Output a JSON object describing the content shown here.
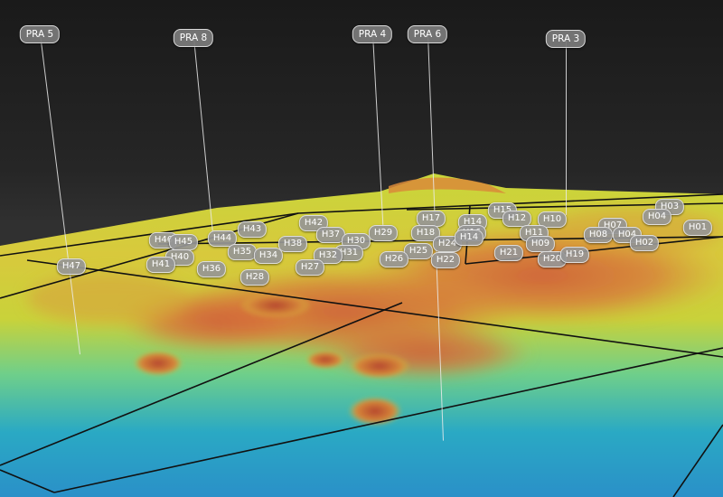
{
  "scene": {
    "colors": {
      "sky": "#1c1c1c",
      "low": "#2aa9c4",
      "mid": "#c8d63a",
      "high": "#d2683a",
      "grid_lines": "#111111",
      "label_bg": "#969696"
    },
    "pra_markers": [
      "PRA 5",
      "PRA 8",
      "PRA 4",
      "PRA 6",
      "PRA 3"
    ],
    "h_labels": [
      "H03",
      "H01",
      "H04",
      "H07",
      "H08",
      "H04",
      "H02",
      "H15",
      "H12",
      "H10",
      "H14",
      "H11",
      "H09",
      "H21",
      "H20",
      "H19",
      "H17",
      "H16",
      "H18",
      "H24",
      "H14",
      "H25",
      "H22",
      "H26",
      "H29",
      "H42",
      "H37",
      "H30",
      "H31",
      "H32",
      "H27",
      "H43",
      "H38",
      "H44",
      "H35",
      "H34",
      "H46",
      "H45",
      "H40",
      "H41",
      "H36",
      "H28",
      "H47"
    ]
  }
}
